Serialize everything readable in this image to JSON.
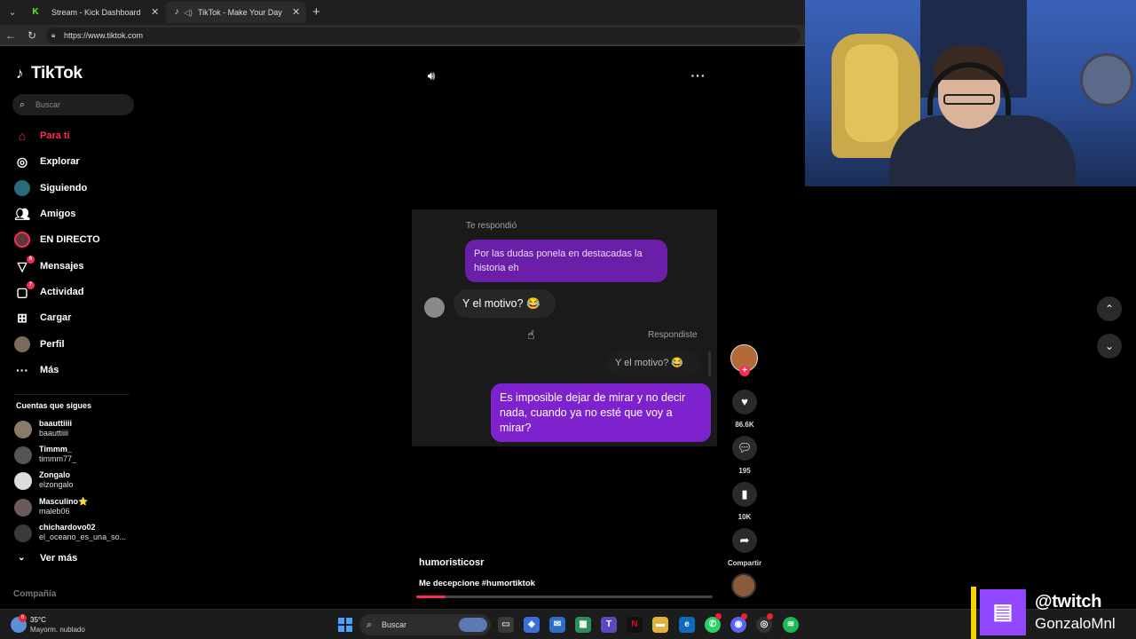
{
  "browser": {
    "tabs": [
      {
        "label": "Stream - Kick Dashboard",
        "favicon": "K"
      },
      {
        "label": "TikTok - Make Your Day",
        "favicon": "♪"
      }
    ],
    "url": "https://www.tiktok.com"
  },
  "sidebar": {
    "logo": "TikTok",
    "search_placeholder": "Buscar",
    "nav": [
      {
        "label": "Para ti",
        "icon": "home-icon",
        "active": true
      },
      {
        "label": "Explorar",
        "icon": "compass-icon"
      },
      {
        "label": "Siguiendo",
        "icon": "following-icon"
      },
      {
        "label": "Amigos",
        "icon": "friends-icon"
      },
      {
        "label": "EN DIRECTO",
        "icon": "live-icon"
      },
      {
        "label": "Mensajes",
        "icon": "send-icon",
        "badge": "6"
      },
      {
        "label": "Actividad",
        "icon": "activity-icon",
        "badge": "7"
      },
      {
        "label": "Cargar",
        "icon": "upload-icon"
      },
      {
        "label": "Perfil",
        "icon": "profile-icon"
      },
      {
        "label": "Más",
        "icon": "more-icon"
      }
    ],
    "following_title": "Cuentas que sigues",
    "accounts": [
      {
        "name": "baauttiiii",
        "handle": "baauttiiii"
      },
      {
        "name": "Timmm_",
        "handle": "timmm77_"
      },
      {
        "name": "Zongalo",
        "handle": "elzongalo"
      },
      {
        "name": "Masculino⭐",
        "handle": "maleb06"
      },
      {
        "name": "chichardovo02",
        "handle": "el_oceano_es_una_so..."
      }
    ],
    "see_more": "Ver más",
    "company": "Compañía"
  },
  "video": {
    "chat": {
      "reply_label_1": "Te respondió",
      "msg_1": "Por las dudas ponela en destacadas la historia eh",
      "msg_2": "Y el motivo? 😂",
      "reply_label_2": "Respondiste",
      "quoted": "Y el motivo? 😂",
      "msg_3": "Es imposible dejar de mirar y no decir nada, cuando ya no esté que voy a mirar?"
    },
    "author": "humoristicosr",
    "caption": "Me decepcione #humortiktok",
    "progress": 0.1
  },
  "actions": {
    "likes": "86.6K",
    "comments": "195",
    "saves": "10K",
    "share": "Compartir"
  },
  "taskbar": {
    "temp": "35°C",
    "weather": "Mayorm. nublado",
    "weather_badge": "6",
    "search": "Buscar"
  },
  "overlay": {
    "twitch_handle": "@twitch",
    "streamer": "GonzaloMnl"
  },
  "colors": {
    "accent": "#fe2c55",
    "bubble_purple": "#7e22ce",
    "twitch": "#9146ff"
  }
}
